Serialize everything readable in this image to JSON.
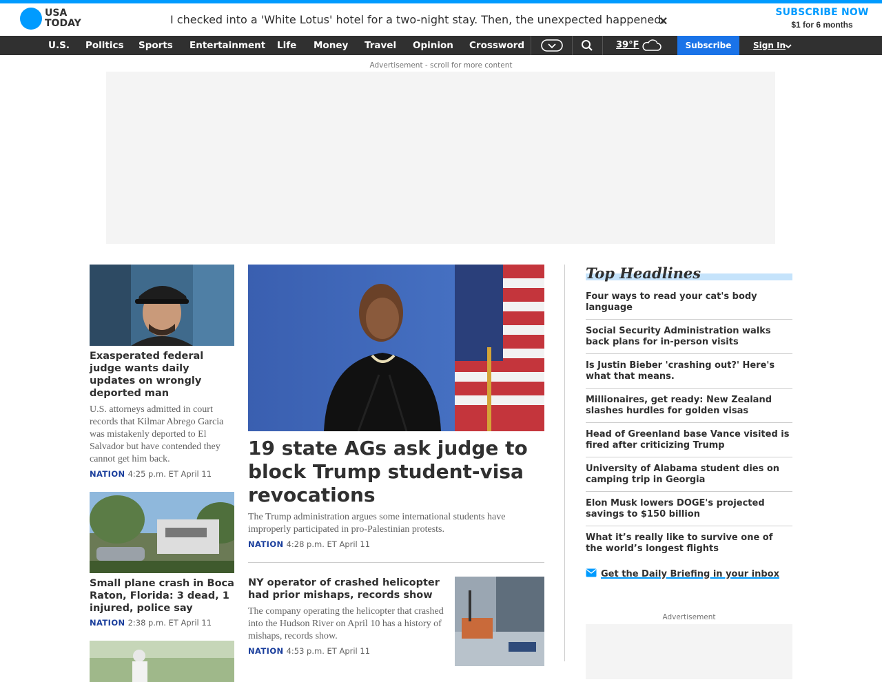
{
  "brand": {
    "line1": "USA",
    "line2": "TODAY"
  },
  "promo": {
    "text": "I checked into a 'White Lotus' hotel for a two-night stay. Then, the unexpected happened.",
    "close": "✕"
  },
  "subscribe_now": {
    "title": "SUBSCRIBE NOW",
    "offer": "$1 for 6 months"
  },
  "nav": {
    "items": [
      "U.S.",
      "Politics",
      "Sports",
      "Entertainment",
      "Life",
      "Money",
      "Travel",
      "Opinion",
      "Crossword"
    ],
    "temperature": "39°F",
    "subscribe": "Subscribe",
    "signin": "Sign In"
  },
  "ad": {
    "label": "Advertisement - scroll for more content"
  },
  "left": [
    {
      "title": "Exasperated federal judge wants daily updates on wrongly deported man",
      "desc": "U.S. attorneys admitted in court records that Kilmar Abrego Garcia was mistakenly deported to El Salvador but have contended they cannot get him back.",
      "category": "NATION",
      "time": "4:25 p.m. ET April 11"
    },
    {
      "title": "Small plane crash in Boca Raton, Florida: 3 dead, 1 injured, police say",
      "category": "NATION",
      "time": "2:38 p.m. ET April 11"
    }
  ],
  "hero": {
    "title": "19 state AGs ask judge to block Trump student-visa revocations",
    "desc": "The Trump administration argues some international students have improperly participated in pro-Palestinian protests.",
    "category": "NATION",
    "time": "4:28 p.m. ET April 11"
  },
  "secondary": {
    "title": "NY operator of crashed helicopter had prior mishaps, records show",
    "desc": "The company operating the helicopter that crashed into the Hudson River on April 10 has a history of mishaps, records show.",
    "category": "NATION",
    "time": "4:53 p.m. ET April 11"
  },
  "top_headlines": {
    "title": "Top Headlines",
    "items": [
      "Four ways to read your cat's body language",
      "Social Security Administration walks back plans for in-person visits",
      "Is Justin Bieber 'crashing out?' Here's what that means.",
      "Millionaires, get ready: New Zealand slashes hurdles for golden visas",
      "Head of Greenland base Vance visited is fired after criticizing Trump",
      "University of Alabama student dies on camping trip in Georgia",
      "Elon Musk lowers DOGE's projected savings to $150 billion",
      "What it’s really like to survive one of the world’s longest flights"
    ],
    "newsletter": "Get the Daily Briefing in your inbox"
  },
  "ad2": {
    "label": "Advertisement"
  }
}
